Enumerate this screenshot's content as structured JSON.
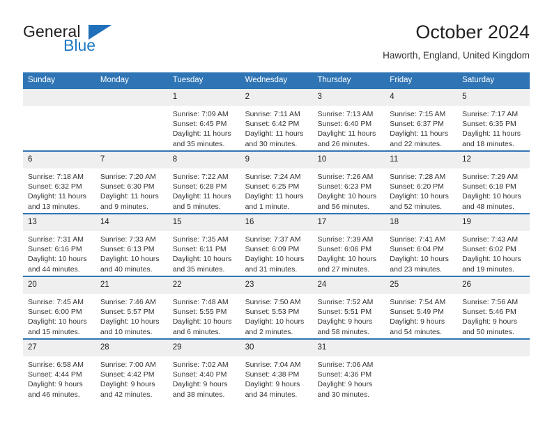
{
  "brand": {
    "name_top": "General",
    "name_bottom": "Blue",
    "accent_color": "#1f6fba",
    "text_color": "#231f20"
  },
  "header": {
    "title": "October 2024",
    "subtitle": "Haworth, England, United Kingdom",
    "header_bar_color": "#2f75b5",
    "day_band_color": "#efefef"
  },
  "weekdays": [
    "Sunday",
    "Monday",
    "Tuesday",
    "Wednesday",
    "Thursday",
    "Friday",
    "Saturday"
  ],
  "weeks": [
    [
      {
        "day": "",
        "sunrise": "",
        "sunset": "",
        "daylight_1": "",
        "daylight_2": ""
      },
      {
        "day": "",
        "sunrise": "",
        "sunset": "",
        "daylight_1": "",
        "daylight_2": ""
      },
      {
        "day": "1",
        "sunrise": "Sunrise: 7:09 AM",
        "sunset": "Sunset: 6:45 PM",
        "daylight_1": "Daylight: 11 hours",
        "daylight_2": "and 35 minutes."
      },
      {
        "day": "2",
        "sunrise": "Sunrise: 7:11 AM",
        "sunset": "Sunset: 6:42 PM",
        "daylight_1": "Daylight: 11 hours",
        "daylight_2": "and 30 minutes."
      },
      {
        "day": "3",
        "sunrise": "Sunrise: 7:13 AM",
        "sunset": "Sunset: 6:40 PM",
        "daylight_1": "Daylight: 11 hours",
        "daylight_2": "and 26 minutes."
      },
      {
        "day": "4",
        "sunrise": "Sunrise: 7:15 AM",
        "sunset": "Sunset: 6:37 PM",
        "daylight_1": "Daylight: 11 hours",
        "daylight_2": "and 22 minutes."
      },
      {
        "day": "5",
        "sunrise": "Sunrise: 7:17 AM",
        "sunset": "Sunset: 6:35 PM",
        "daylight_1": "Daylight: 11 hours",
        "daylight_2": "and 18 minutes."
      }
    ],
    [
      {
        "day": "6",
        "sunrise": "Sunrise: 7:18 AM",
        "sunset": "Sunset: 6:32 PM",
        "daylight_1": "Daylight: 11 hours",
        "daylight_2": "and 13 minutes."
      },
      {
        "day": "7",
        "sunrise": "Sunrise: 7:20 AM",
        "sunset": "Sunset: 6:30 PM",
        "daylight_1": "Daylight: 11 hours",
        "daylight_2": "and 9 minutes."
      },
      {
        "day": "8",
        "sunrise": "Sunrise: 7:22 AM",
        "sunset": "Sunset: 6:28 PM",
        "daylight_1": "Daylight: 11 hours",
        "daylight_2": "and 5 minutes."
      },
      {
        "day": "9",
        "sunrise": "Sunrise: 7:24 AM",
        "sunset": "Sunset: 6:25 PM",
        "daylight_1": "Daylight: 11 hours",
        "daylight_2": "and 1 minute."
      },
      {
        "day": "10",
        "sunrise": "Sunrise: 7:26 AM",
        "sunset": "Sunset: 6:23 PM",
        "daylight_1": "Daylight: 10 hours",
        "daylight_2": "and 56 minutes."
      },
      {
        "day": "11",
        "sunrise": "Sunrise: 7:28 AM",
        "sunset": "Sunset: 6:20 PM",
        "daylight_1": "Daylight: 10 hours",
        "daylight_2": "and 52 minutes."
      },
      {
        "day": "12",
        "sunrise": "Sunrise: 7:29 AM",
        "sunset": "Sunset: 6:18 PM",
        "daylight_1": "Daylight: 10 hours",
        "daylight_2": "and 48 minutes."
      }
    ],
    [
      {
        "day": "13",
        "sunrise": "Sunrise: 7:31 AM",
        "sunset": "Sunset: 6:16 PM",
        "daylight_1": "Daylight: 10 hours",
        "daylight_2": "and 44 minutes."
      },
      {
        "day": "14",
        "sunrise": "Sunrise: 7:33 AM",
        "sunset": "Sunset: 6:13 PM",
        "daylight_1": "Daylight: 10 hours",
        "daylight_2": "and 40 minutes."
      },
      {
        "day": "15",
        "sunrise": "Sunrise: 7:35 AM",
        "sunset": "Sunset: 6:11 PM",
        "daylight_1": "Daylight: 10 hours",
        "daylight_2": "and 35 minutes."
      },
      {
        "day": "16",
        "sunrise": "Sunrise: 7:37 AM",
        "sunset": "Sunset: 6:09 PM",
        "daylight_1": "Daylight: 10 hours",
        "daylight_2": "and 31 minutes."
      },
      {
        "day": "17",
        "sunrise": "Sunrise: 7:39 AM",
        "sunset": "Sunset: 6:06 PM",
        "daylight_1": "Daylight: 10 hours",
        "daylight_2": "and 27 minutes."
      },
      {
        "day": "18",
        "sunrise": "Sunrise: 7:41 AM",
        "sunset": "Sunset: 6:04 PM",
        "daylight_1": "Daylight: 10 hours",
        "daylight_2": "and 23 minutes."
      },
      {
        "day": "19",
        "sunrise": "Sunrise: 7:43 AM",
        "sunset": "Sunset: 6:02 PM",
        "daylight_1": "Daylight: 10 hours",
        "daylight_2": "and 19 minutes."
      }
    ],
    [
      {
        "day": "20",
        "sunrise": "Sunrise: 7:45 AM",
        "sunset": "Sunset: 6:00 PM",
        "daylight_1": "Daylight: 10 hours",
        "daylight_2": "and 15 minutes."
      },
      {
        "day": "21",
        "sunrise": "Sunrise: 7:46 AM",
        "sunset": "Sunset: 5:57 PM",
        "daylight_1": "Daylight: 10 hours",
        "daylight_2": "and 10 minutes."
      },
      {
        "day": "22",
        "sunrise": "Sunrise: 7:48 AM",
        "sunset": "Sunset: 5:55 PM",
        "daylight_1": "Daylight: 10 hours",
        "daylight_2": "and 6 minutes."
      },
      {
        "day": "23",
        "sunrise": "Sunrise: 7:50 AM",
        "sunset": "Sunset: 5:53 PM",
        "daylight_1": "Daylight: 10 hours",
        "daylight_2": "and 2 minutes."
      },
      {
        "day": "24",
        "sunrise": "Sunrise: 7:52 AM",
        "sunset": "Sunset: 5:51 PM",
        "daylight_1": "Daylight: 9 hours",
        "daylight_2": "and 58 minutes."
      },
      {
        "day": "25",
        "sunrise": "Sunrise: 7:54 AM",
        "sunset": "Sunset: 5:49 PM",
        "daylight_1": "Daylight: 9 hours",
        "daylight_2": "and 54 minutes."
      },
      {
        "day": "26",
        "sunrise": "Sunrise: 7:56 AM",
        "sunset": "Sunset: 5:46 PM",
        "daylight_1": "Daylight: 9 hours",
        "daylight_2": "and 50 minutes."
      }
    ],
    [
      {
        "day": "27",
        "sunrise": "Sunrise: 6:58 AM",
        "sunset": "Sunset: 4:44 PM",
        "daylight_1": "Daylight: 9 hours",
        "daylight_2": "and 46 minutes."
      },
      {
        "day": "28",
        "sunrise": "Sunrise: 7:00 AM",
        "sunset": "Sunset: 4:42 PM",
        "daylight_1": "Daylight: 9 hours",
        "daylight_2": "and 42 minutes."
      },
      {
        "day": "29",
        "sunrise": "Sunrise: 7:02 AM",
        "sunset": "Sunset: 4:40 PM",
        "daylight_1": "Daylight: 9 hours",
        "daylight_2": "and 38 minutes."
      },
      {
        "day": "30",
        "sunrise": "Sunrise: 7:04 AM",
        "sunset": "Sunset: 4:38 PM",
        "daylight_1": "Daylight: 9 hours",
        "daylight_2": "and 34 minutes."
      },
      {
        "day": "31",
        "sunrise": "Sunrise: 7:06 AM",
        "sunset": "Sunset: 4:36 PM",
        "daylight_1": "Daylight: 9 hours",
        "daylight_2": "and 30 minutes."
      },
      {
        "day": "",
        "sunrise": "",
        "sunset": "",
        "daylight_1": "",
        "daylight_2": ""
      },
      {
        "day": "",
        "sunrise": "",
        "sunset": "",
        "daylight_1": "",
        "daylight_2": ""
      }
    ]
  ]
}
